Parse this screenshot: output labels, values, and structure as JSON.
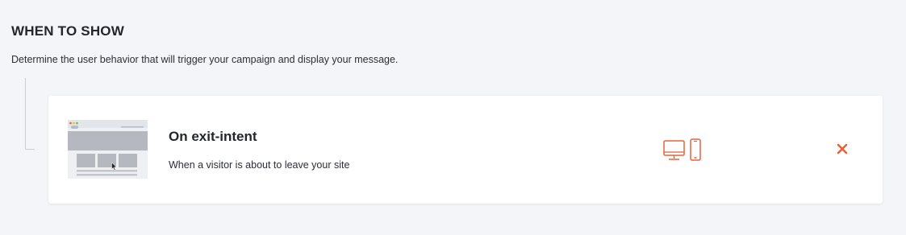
{
  "section": {
    "title": "WHEN TO SHOW",
    "description": "Determine the user behavior that will trigger your campaign and display your message."
  },
  "trigger": {
    "title": "On exit-intent",
    "description": "When a visitor is about to leave your site",
    "devices": [
      "desktop-icon",
      "mobile-icon"
    ],
    "remove_icon": "close-icon"
  },
  "colors": {
    "accent": "#e8623a",
    "background": "#f3f5f8",
    "card": "#ffffff"
  }
}
